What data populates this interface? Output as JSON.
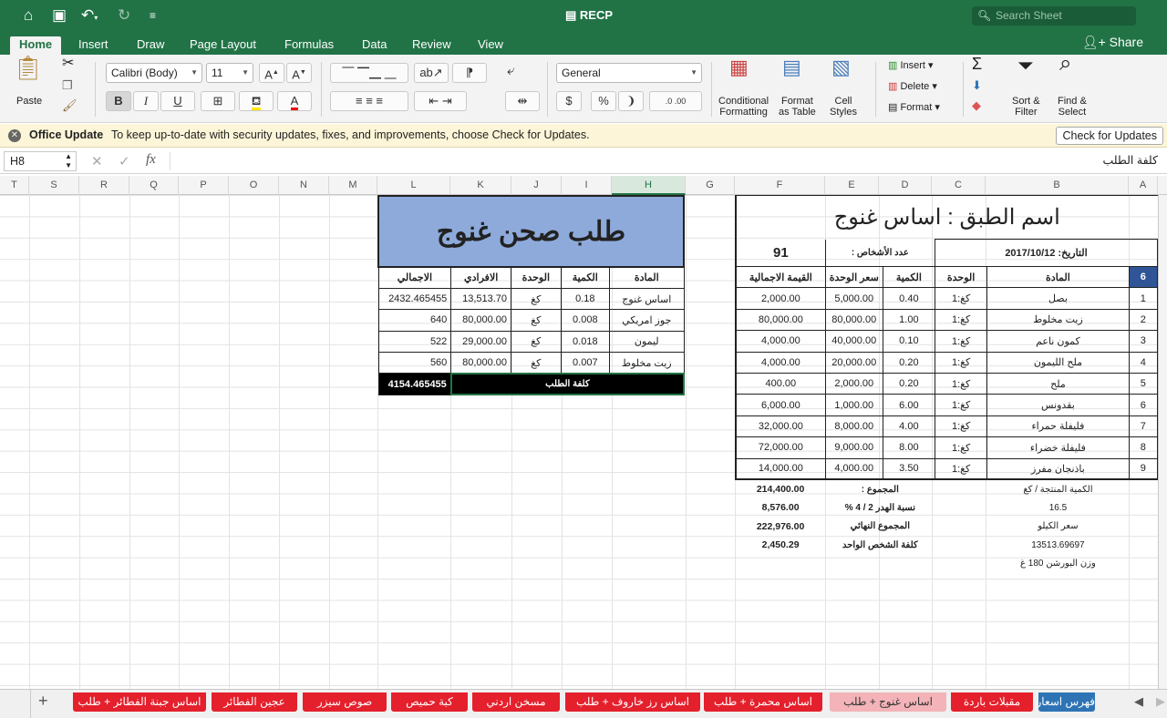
{
  "app": {
    "title": "RECP",
    "search_placeholder": "Search Sheet",
    "share": "Share"
  },
  "ribbon_tabs": [
    "Home",
    "Insert",
    "Draw",
    "Page Layout",
    "Formulas",
    "Data",
    "Review",
    "View"
  ],
  "ribbon": {
    "paste": "Paste",
    "font_name": "Calibri (Body)",
    "font_size": "11",
    "number_format": "General",
    "bold": "B",
    "italic": "I",
    "underline": "U",
    "currency": "$",
    "percent": "%",
    "comma": "❩",
    "dec_inc": ".0 .00",
    "dec_dec": ".00 .0",
    "conditional_formatting": [
      "Conditional",
      "Formatting"
    ],
    "format_as_table": [
      "Format",
      "as Table"
    ],
    "cell_styles": [
      "Cell",
      "Styles"
    ],
    "insert": "Insert",
    "delete": "Delete",
    "format": "Format",
    "sort_filter": [
      "Sort &",
      "Filter"
    ],
    "find_select": [
      "Find &",
      "Select"
    ]
  },
  "info": {
    "title": "Office Update",
    "message": "To keep up-to-date with security updates, fixes, and improvements, choose Check for Updates.",
    "button": "Check for Updates"
  },
  "formula": {
    "cell": "H8",
    "value": "كلفة الطلب"
  },
  "columns": [
    "T",
    "S",
    "R",
    "Q",
    "P",
    "O",
    "N",
    "M",
    "L",
    "K",
    "J",
    "I",
    "H",
    "G",
    "F",
    "E",
    "D",
    "C",
    "B",
    "A"
  ],
  "right_table": {
    "title": "اسم الطبق : اساس غنوج",
    "date_label": "التاريخ: 2017/10/12",
    "persons_label": "عدد الأشخاص :",
    "persons_value": "91",
    "headers": {
      "idx": "6",
      "item": "المادة",
      "unit": "الوحدة",
      "qty": "الكمية",
      "unit_price": "سعر الوحدة",
      "total": "القيمة الاجمالية"
    },
    "rows": [
      {
        "idx": "1",
        "item": "بصل",
        "unit": "كغ:1",
        "qty": "0.40",
        "unit_price": "5,000.00",
        "total": "2,000.00"
      },
      {
        "idx": "2",
        "item": "زيت مخلوط",
        "unit": "كغ:1",
        "qty": "1.00",
        "unit_price": "80,000.00",
        "total": "80,000.00"
      },
      {
        "idx": "3",
        "item": "كمون ناعم",
        "unit": "كغ:1",
        "qty": "0.10",
        "unit_price": "40,000.00",
        "total": "4,000.00"
      },
      {
        "idx": "4",
        "item": "ملح الليمون",
        "unit": "كغ:1",
        "qty": "0.20",
        "unit_price": "20,000.00",
        "total": "4,000.00"
      },
      {
        "idx": "5",
        "item": "ملح",
        "unit": "كغ:1",
        "qty": "0.20",
        "unit_price": "2,000.00",
        "total": "400.00"
      },
      {
        "idx": "6",
        "item": "بقدونس",
        "unit": "كغ:1",
        "qty": "6.00",
        "unit_price": "1,000.00",
        "total": "6,000.00"
      },
      {
        "idx": "7",
        "item": "فليفلة حمراء",
        "unit": "كغ:1",
        "qty": "4.00",
        "unit_price": "8,000.00",
        "total": "32,000.00"
      },
      {
        "idx": "8",
        "item": "فليفلة خضراء",
        "unit": "كغ:1",
        "qty": "8.00",
        "unit_price": "9,000.00",
        "total": "72,000.00"
      },
      {
        "idx": "9",
        "item": "باذنجان مفرز",
        "unit": "كغ:1",
        "qty": "3.50",
        "unit_price": "4,000.00",
        "total": "14,000.00"
      }
    ],
    "summary": [
      {
        "label": "المجموع :",
        "value": "214,400.00",
        "b_text": "الكمية المنتجة / كغ"
      },
      {
        "label": "نسبة الهدر 2 / 4 %",
        "value": "8,576.00",
        "b_text": "16.5"
      },
      {
        "label": "المجموع النهائي",
        "value": "222,976.00",
        "b_text": "سعر الكيلو"
      },
      {
        "label": "كلفة الشخص الواحد",
        "value": "2,450.29",
        "b_text": "13513.69697"
      },
      {
        "label": "",
        "value": "",
        "b_text": "وزن البورشن 180 غ"
      }
    ]
  },
  "left_table": {
    "title": "طلب صحن غنوج",
    "headers": {
      "item": "المادة",
      "qty": "الكمية",
      "unit": "الوحدة",
      "unit_price": "الافرادي",
      "total": "الاجمالي"
    },
    "rows": [
      {
        "item": "اساس غنوج",
        "qty": "0.18",
        "unit": "كغ",
        "unit_price": "13,513.70",
        "total": "2432.465455"
      },
      {
        "item": "جوز امريكي",
        "qty": "0.008",
        "unit": "كغ",
        "unit_price": "80,000.00",
        "total": "640"
      },
      {
        "item": "ليمون",
        "qty": "0.018",
        "unit": "كغ",
        "unit_price": "29,000.00",
        "total": "522"
      },
      {
        "item": "زيت مخلوط",
        "qty": "0.007",
        "unit": "كغ",
        "unit_price": "80,000.00",
        "total": "560"
      }
    ],
    "cost_label": "كلفة الطلب",
    "cost_total": "4154.465455"
  },
  "sheet_tabs": [
    "فهرس اسعار",
    "مقبلات باردة",
    "اساس غنوج + طلب",
    "اساس محمرة + طلب",
    "اساس رز خاروف + طلب",
    "مسخن اردني",
    "كبة حميص",
    "صوص سيزر",
    "عجين الفطائر",
    "اساس جبنة الفطائر + طلب"
  ],
  "colors": {
    "excel_green": "#217346",
    "title_fill": "#8eaadb",
    "tab_red": "#e4202c",
    "tab_active": "#f3b3b8",
    "tab_blue": "#2e74b5"
  }
}
